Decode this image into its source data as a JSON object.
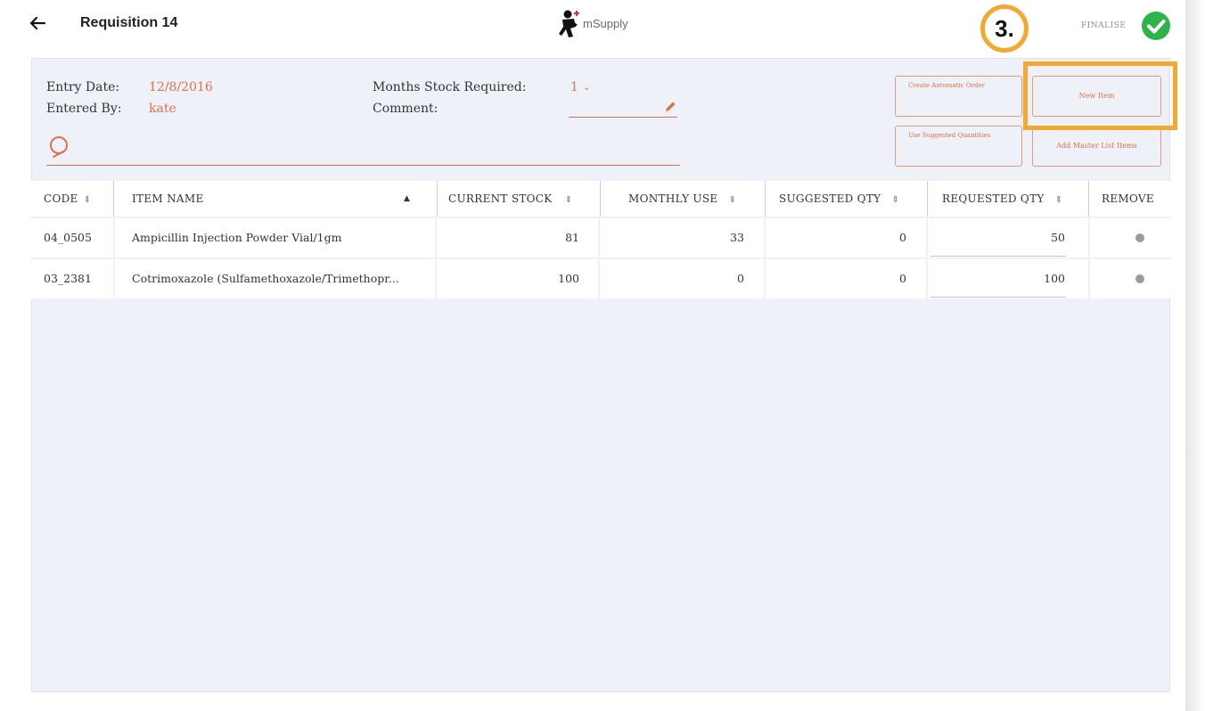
{
  "header": {
    "title": "Requisition 14",
    "logo_text": "mSupply",
    "step_label": "3.",
    "finalise_label": "FINALISE"
  },
  "info": {
    "entry_date_label": "Entry Date:",
    "entry_date_value": "12/8/2016",
    "entered_by_label": "Entered By:",
    "entered_by_value": "kate",
    "months_stock_label": "Months Stock Required:",
    "months_stock_value": "1",
    "comment_label": "Comment:",
    "comment_value": ""
  },
  "buttons": {
    "create_automatic_order": "Create Automatic Order",
    "new_item": "New Item",
    "use_suggested_quantities": "Use Suggested Quantities",
    "add_master_list_items": "Add Master List Items"
  },
  "table": {
    "columns": [
      "CODE",
      "ITEM NAME",
      "CURRENT STOCK",
      "MONTHLY USE",
      "SUGGESTED QTY",
      "REQUESTED QTY",
      "REMOVE"
    ],
    "rows": [
      {
        "code": "04_0505",
        "item_name": "Ampicillin Injection Powder Vial/1gm",
        "current_stock": "81",
        "monthly_use": "33",
        "suggested_qty": "0",
        "requested_qty": "50"
      },
      {
        "code": "03_2381",
        "item_name": "Cotrimoxazole (Sulfamethoxazole/Trimethopr...",
        "current_stock": "100",
        "monthly_use": "0",
        "suggested_qty": "0",
        "requested_qty": "100"
      }
    ]
  },
  "colors": {
    "accent": "#e0704a",
    "highlight": "#f3a832",
    "finalise_green": "#2db34a",
    "panel_background": "#eef1f7"
  },
  "icons": {
    "back": "back-arrow-icon",
    "finalise": "check-circle-icon",
    "search": "search-icon",
    "comment_edit": "pencil-icon",
    "sort": "sort-icon",
    "remove": "remove-icon"
  }
}
